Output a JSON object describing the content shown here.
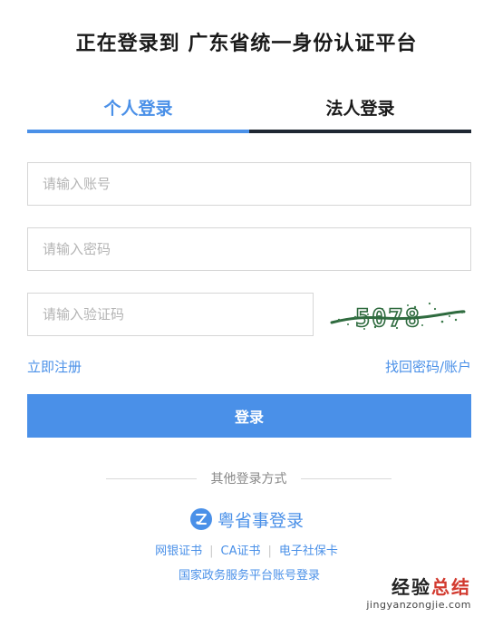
{
  "page": {
    "title": "正在登录到 广东省统一身份认证平台"
  },
  "tabs": [
    {
      "label": "个人登录",
      "active": true
    },
    {
      "label": "法人登录",
      "active": false
    }
  ],
  "form": {
    "account_placeholder": "请输入账号",
    "password_placeholder": "请输入密码",
    "captcha_placeholder": "请输入验证码",
    "captcha_text": "5078",
    "register_label": "立即注册",
    "recover_label": "找回密码/账户",
    "login_label": "登录"
  },
  "other_login": {
    "divider_label": "其他登录方式",
    "yss_label": "粤省事登录",
    "alt_methods": [
      "网银证书",
      "CA证书",
      "电子社保卡"
    ],
    "national_label": "国家政务服务平台账号登录"
  },
  "watermark": {
    "main_black": "经验",
    "main_red": "总结",
    "url": "jingyanzongjie.com"
  },
  "colors": {
    "accent": "#4a90e8",
    "tab_inactive_bar": "#1f2733"
  }
}
